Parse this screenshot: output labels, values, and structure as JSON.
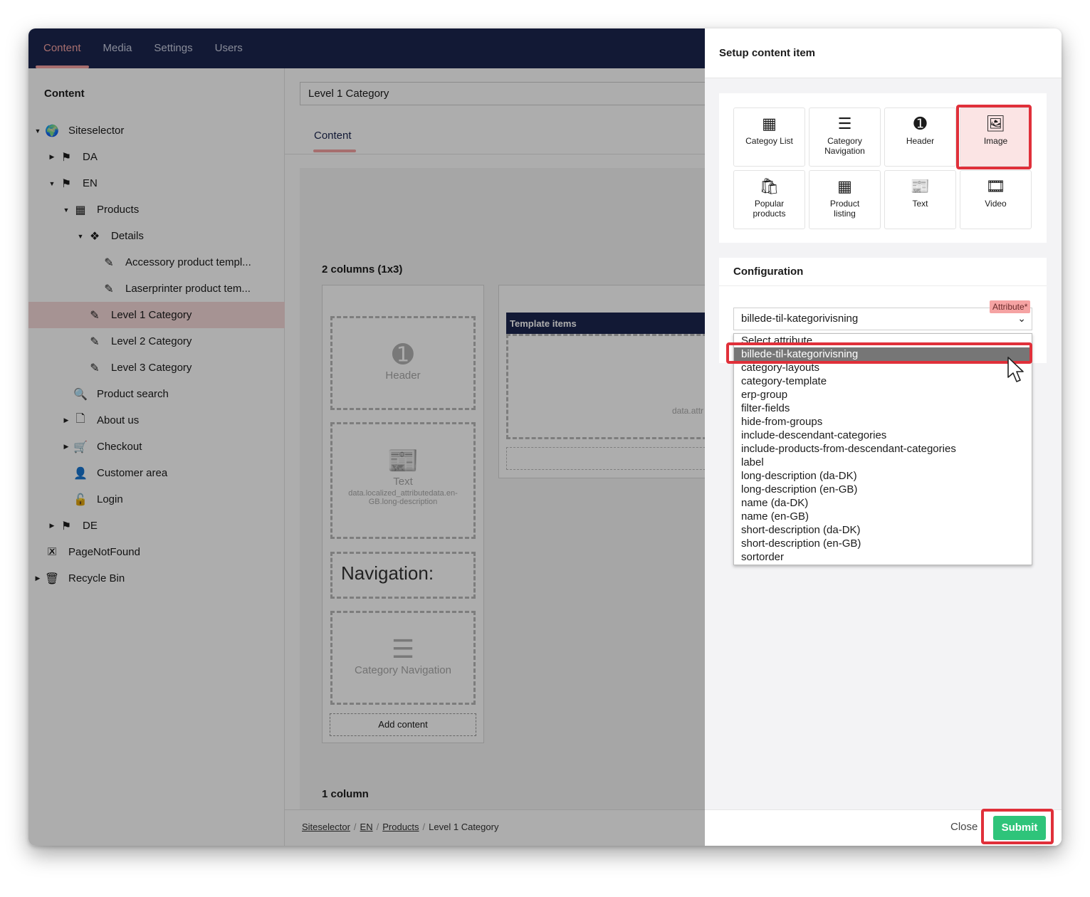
{
  "topnav": {
    "tabs": [
      "Content",
      "Media",
      "Settings",
      "Users"
    ]
  },
  "sidebar": {
    "title": "Content",
    "items": [
      {
        "label": "Siteselector",
        "caret": "▼",
        "icon": "globe-icon",
        "glyph": "🌍"
      },
      {
        "label": "DA",
        "caret": "▶",
        "icon": "flag-icon",
        "glyph": "⚑"
      },
      {
        "label": "EN",
        "caret": "▼",
        "icon": "flag-icon",
        "glyph": "⚑"
      },
      {
        "label": "Products",
        "caret": "▼",
        "icon": "grid-icon",
        "glyph": "▦"
      },
      {
        "label": "Details",
        "caret": "▼",
        "icon": "boxes-icon",
        "glyph": "❖"
      },
      {
        "label": "Accessory product templ...",
        "caret": "",
        "icon": "edit-icon",
        "glyph": "✎"
      },
      {
        "label": "Laserprinter product tem...",
        "caret": "",
        "icon": "edit-icon",
        "glyph": "✎"
      },
      {
        "label": "Level 1 Category",
        "caret": "",
        "icon": "edit-icon",
        "glyph": "✎"
      },
      {
        "label": "Level 2 Category",
        "caret": "",
        "icon": "edit-icon",
        "glyph": "✎"
      },
      {
        "label": "Level 3 Category",
        "caret": "",
        "icon": "edit-icon",
        "glyph": "✎"
      },
      {
        "label": "Product search",
        "caret": "",
        "icon": "search-icon",
        "glyph": "🔍"
      },
      {
        "label": "About us",
        "caret": "▶",
        "icon": "page-icon",
        "glyph": "🗋"
      },
      {
        "label": "Checkout",
        "caret": "▶",
        "icon": "cart-icon",
        "glyph": "🛒"
      },
      {
        "label": "Customer area",
        "caret": "",
        "icon": "user-icon",
        "glyph": "👤"
      },
      {
        "label": "Login",
        "caret": "",
        "icon": "unlock-icon",
        "glyph": "🔓"
      },
      {
        "label": "DE",
        "caret": "▶",
        "icon": "flag-icon",
        "glyph": "⚑"
      },
      {
        "label": "PageNotFound",
        "caret": "",
        "icon": "calendar-x-icon",
        "glyph": "🗷"
      },
      {
        "label": "Recycle Bin",
        "caret": "▶",
        "icon": "trash-icon",
        "glyph": "🗑"
      }
    ]
  },
  "main": {
    "page_title": "Level 1 Category",
    "tab": "Content",
    "section1_title": "2 columns (1x3)",
    "section2_title": "1 column",
    "placeholders": {
      "header": "Header",
      "text": "Text",
      "text_sub": "data.localized_attributedata.en-GB.long-description",
      "navigation": "Navigation:",
      "category_nav": "Category Navigation"
    },
    "add_content": "Add content",
    "template_items": "Template items",
    "template_sub": "data.attr",
    "breadcrumb": [
      "Siteselector",
      "EN",
      "Products",
      "Level 1 Category"
    ]
  },
  "panel": {
    "title": "Setup content item",
    "tiles": [
      {
        "label": "Categoy List",
        "icon": "grid-icon",
        "glyph": "▦"
      },
      {
        "label": "Category Navigation",
        "icon": "list-icon",
        "glyph": "☰"
      },
      {
        "label": "Header",
        "icon": "header-number-icon",
        "glyph": "➊"
      },
      {
        "label": "Image",
        "icon": "image-icon",
        "glyph": "🖼"
      },
      {
        "label": "Popular products",
        "icon": "bag-icon",
        "glyph": "🛍"
      },
      {
        "label": "Product listing",
        "icon": "grid-icon",
        "glyph": "▦"
      },
      {
        "label": "Text",
        "icon": "text-doc-icon",
        "glyph": "📰"
      },
      {
        "label": "Video",
        "icon": "film-icon",
        "glyph": "🎞"
      }
    ],
    "selected_tile": "Image",
    "config_title": "Configuration",
    "attribute_badge": "Attribute*",
    "select_value": "billede-til-kategorivisning",
    "options": [
      "Select attribute",
      "billede-til-kategorivisning",
      "category-layouts",
      "category-template",
      "erp-group",
      "filter-fields",
      "hide-from-groups",
      "include-descendant-categories",
      "include-products-from-descendant-categories",
      "label",
      "long-description (da-DK)",
      "long-description (en-GB)",
      "name (da-DK)",
      "name (en-GB)",
      "short-description (da-DK)",
      "short-description (en-GB)",
      "sortorder"
    ],
    "close_label": "Close",
    "submit_label": "Submit",
    "highlight_color": "#e0303a",
    "submit_color": "#2ec47a",
    "nav_color": "#1b264f"
  }
}
